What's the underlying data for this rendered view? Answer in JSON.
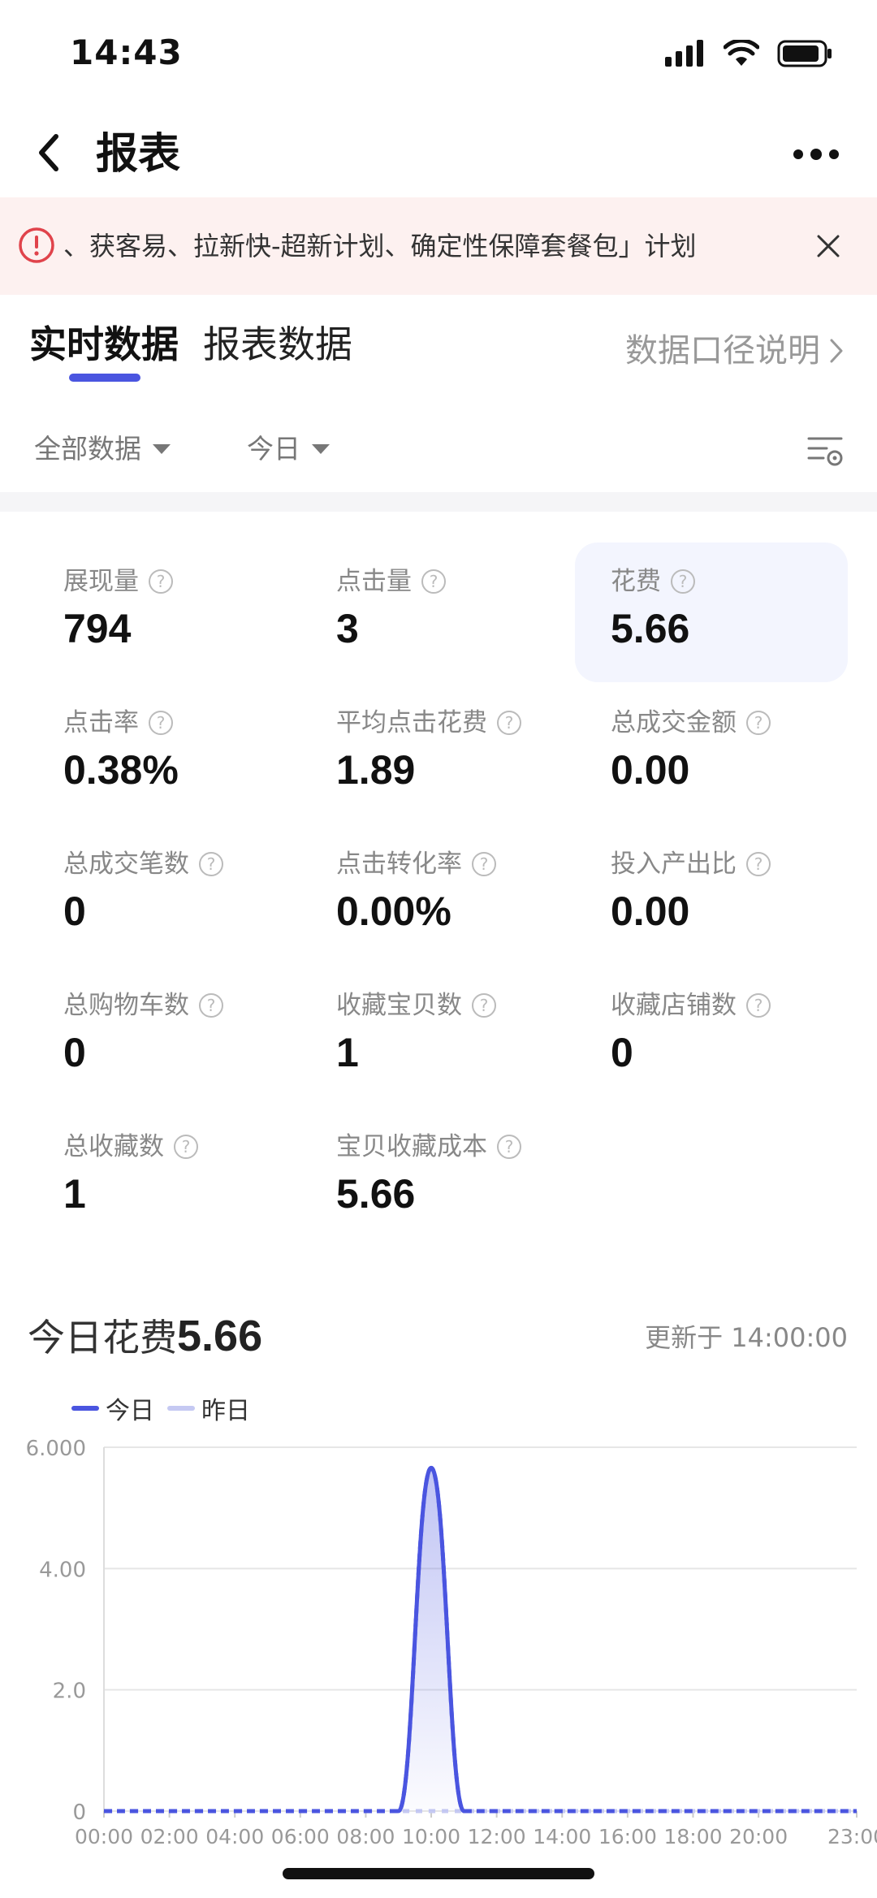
{
  "status_bar": {
    "time": "14:43"
  },
  "nav": {
    "title": "报表"
  },
  "notice": {
    "text": "、获客易、拉新快-超新计划、确定性保障套餐包」计划"
  },
  "tabs": [
    {
      "label": "实时数据",
      "active": true
    },
    {
      "label": "报表数据",
      "active": false
    }
  ],
  "data_caliber": {
    "label": "数据口径说明"
  },
  "filters": {
    "scope": "全部数据",
    "date": "今日"
  },
  "metrics": [
    {
      "label": "展现量",
      "value": "794"
    },
    {
      "label": "点击量",
      "value": "3"
    },
    {
      "label": "花费",
      "value": "5.66",
      "highlight": true
    },
    {
      "label": "点击率",
      "value": "0.38%"
    },
    {
      "label": "平均点击花费",
      "value": "1.89"
    },
    {
      "label": "总成交金额",
      "value": "0.00"
    },
    {
      "label": "总成交笔数",
      "value": "0"
    },
    {
      "label": "点击转化率",
      "value": "0.00%"
    },
    {
      "label": "投入产出比",
      "value": "0.00"
    },
    {
      "label": "总购物车数",
      "value": "0"
    },
    {
      "label": "收藏宝贝数",
      "value": "1"
    },
    {
      "label": "收藏店铺数",
      "value": "0"
    },
    {
      "label": "总收藏数",
      "value": "1"
    },
    {
      "label": "宝贝收藏成本",
      "value": "5.66"
    }
  ],
  "spend": {
    "title": "今日花费",
    "value": "5.66",
    "updated": "更新于 14:00:00"
  },
  "colors": {
    "accent": "#4a55e0",
    "yesterday": "#c5c9f2",
    "notice_bg": "#fdf1f0",
    "notice_icon": "#e0434b"
  },
  "chart_data": {
    "type": "line",
    "x": [
      "00:00",
      "01:00",
      "02:00",
      "03:00",
      "04:00",
      "05:00",
      "06:00",
      "07:00",
      "08:00",
      "09:00",
      "10:00",
      "11:00",
      "12:00",
      "13:00",
      "14:00",
      "15:00",
      "16:00",
      "17:00",
      "18:00",
      "19:00",
      "20:00",
      "21:00",
      "22:00",
      "23:00"
    ],
    "x_tick_labels": [
      "00:00",
      "02:00",
      "04:00",
      "06:00",
      "08:00",
      "10:00",
      "12:00",
      "14:00",
      "16:00",
      "18:00",
      "20:00",
      "23:00"
    ],
    "y_tick_labels": [
      "6.000",
      "4.00",
      "2.0",
      "0"
    ],
    "ylim": [
      0,
      6
    ],
    "series": [
      {
        "name": "今日",
        "values": [
          0,
          0,
          0,
          0,
          0,
          0,
          0,
          0,
          0,
          0,
          5.66,
          0,
          0,
          0,
          0,
          0,
          0,
          0,
          0,
          0,
          0,
          0,
          0,
          0
        ]
      },
      {
        "name": "昨日",
        "values": [
          0,
          0,
          0,
          0,
          0,
          0,
          0,
          0,
          0,
          0,
          0,
          0,
          0,
          0,
          0,
          0,
          0,
          0,
          0,
          0,
          0,
          0,
          0,
          0
        ]
      }
    ],
    "grid": true,
    "legend": "top-left"
  }
}
